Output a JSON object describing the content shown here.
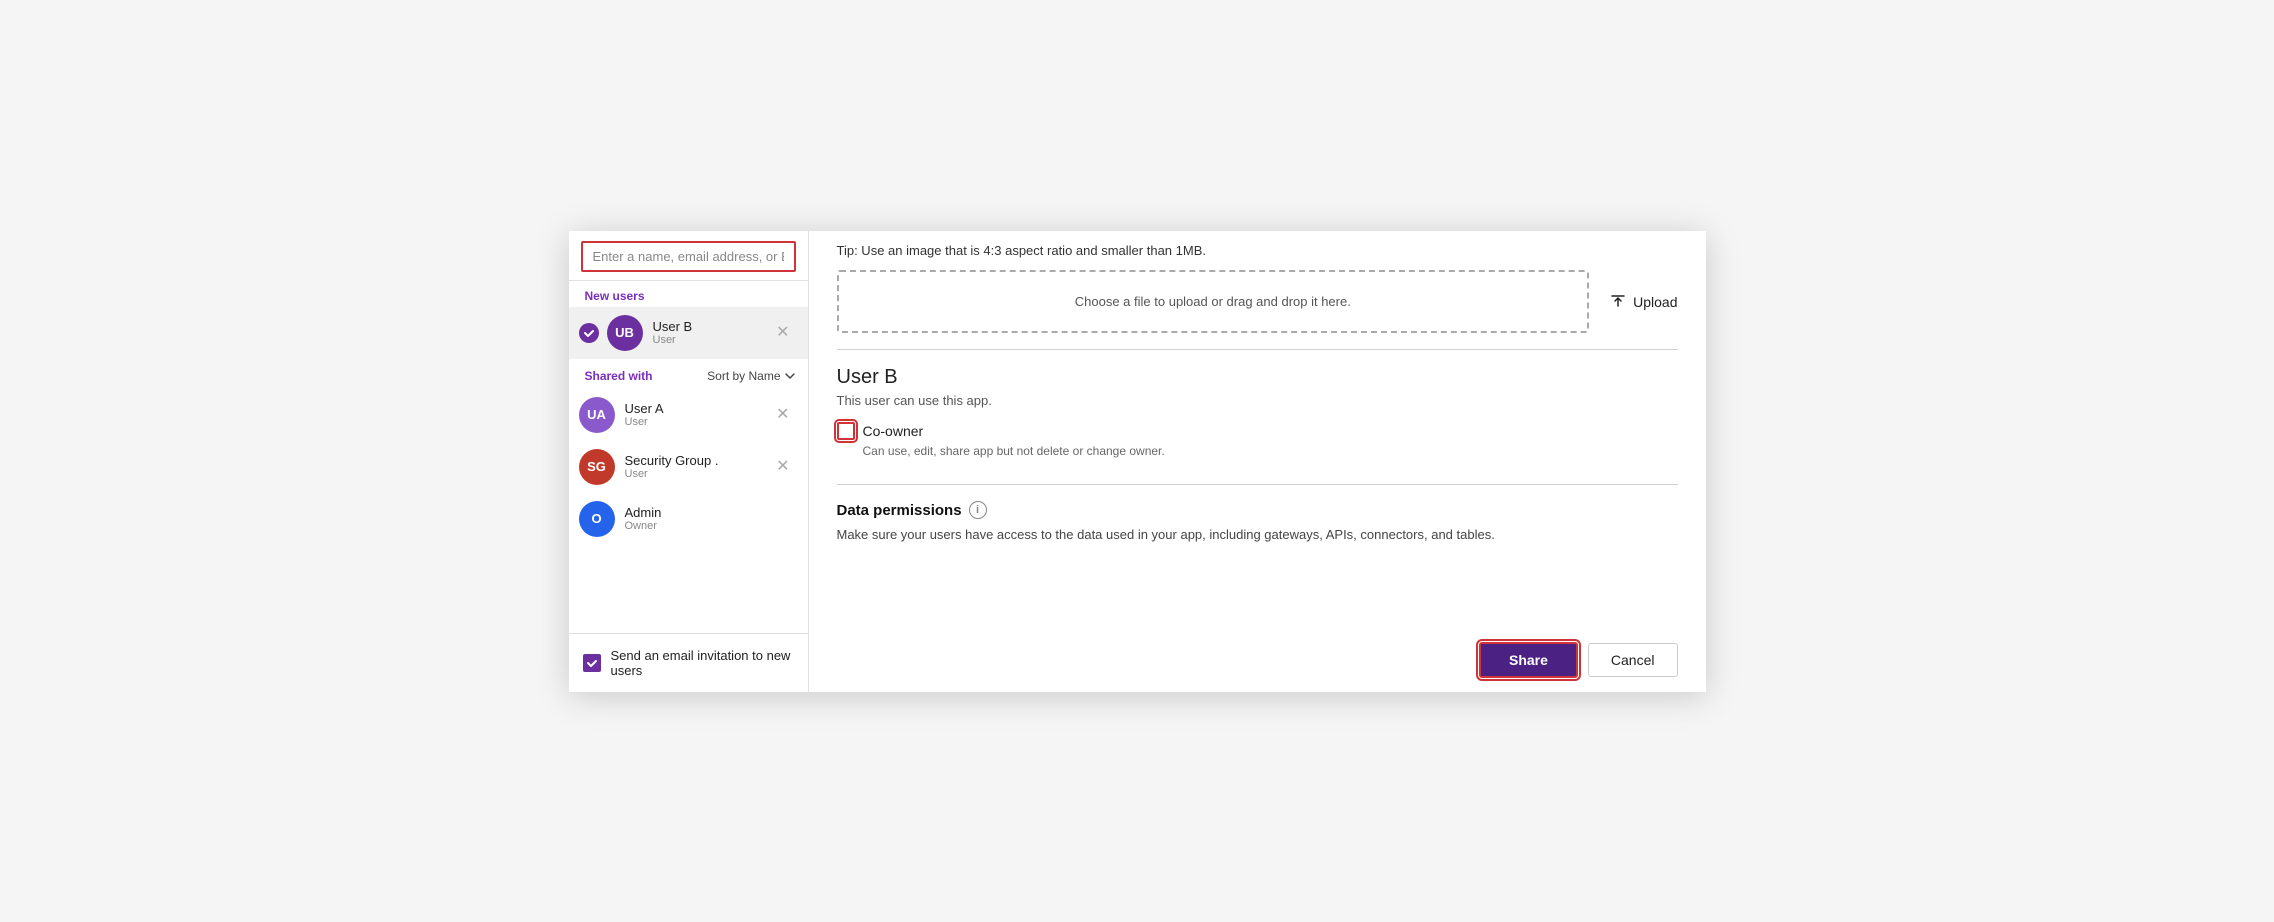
{
  "search": {
    "placeholder": "Enter a name, email address, or Everyone"
  },
  "new_users": {
    "label": "New users"
  },
  "selected_user": {
    "initials": "UB",
    "name": "User B",
    "role": "User"
  },
  "shared_with": {
    "label": "Shared with",
    "sort_label": "Sort by Name"
  },
  "shared_users": [
    {
      "initials": "UA",
      "name": "User A",
      "role": "User",
      "color": "ua"
    },
    {
      "initials": "SG",
      "name": "Security Group .",
      "role": "User",
      "color": "sg"
    },
    {
      "initials": "O",
      "name": "Admin",
      "role": "Owner",
      "color": "o"
    }
  ],
  "email_invite": {
    "label": "Send an email invitation to new users"
  },
  "right_panel": {
    "tip_label": "Tip: Use an image that is 4:3 aspect ratio and smaller than 1MB.",
    "drop_zone_text": "Choose a file to upload or drag and drop it here.",
    "upload_label": "Upload",
    "user_title": "User B",
    "user_subtitle": "This user can use this app.",
    "coowner_label": "Co-owner",
    "coowner_desc": "Can use, edit, share app but not delete or change owner.",
    "data_permissions_label": "Data permissions",
    "data_permissions_desc": "Make sure your users have access to the data used in your app, including gateways, APIs, connectors, and tables.",
    "share_button": "Share",
    "cancel_button": "Cancel"
  }
}
